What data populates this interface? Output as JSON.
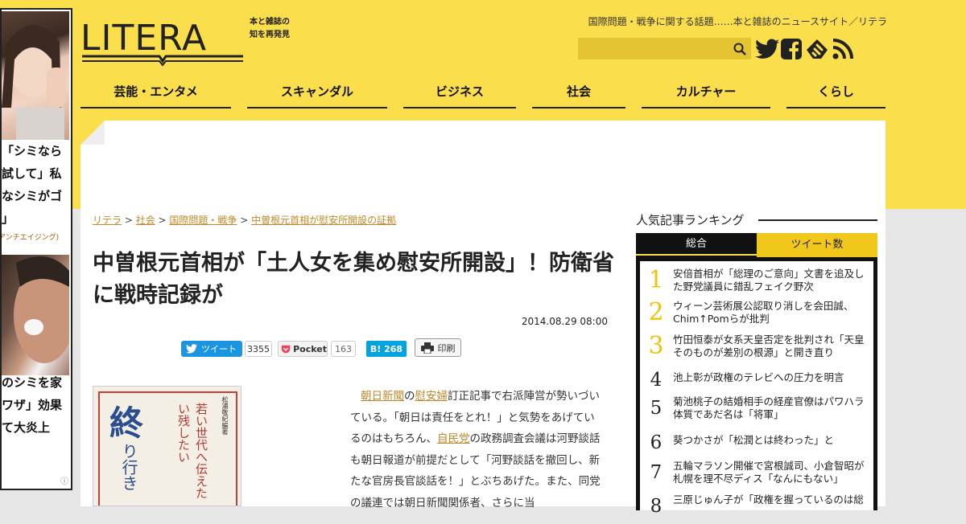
{
  "ad_left": {
    "line1": "「シミなら",
    "line2": "試して」私",
    "line3": "なシミがゴ",
    "line4": "」",
    "small": "アンチエイジング)",
    "line5": "のシミを家",
    "line6": "ワザ」効果",
    "line7": "て大炎上",
    "info_icon": "info-icon"
  },
  "header": {
    "logo_text": "LITERA",
    "logo_sub1": "本と雑誌の",
    "logo_sub2": "知を再発見",
    "tagline": "国際問題・戦争に関する話題……本と雑誌のニュースサイト／リテラ",
    "search_placeholder": ""
  },
  "nav": [
    "芸能・エンタメ",
    "スキャンダル",
    "ビジネス",
    "社会",
    "カルチャー",
    "くらし"
  ],
  "breadcrumb": {
    "home": "リテラ",
    "sep1": " > ",
    "cat1": "社会",
    "sep2": " > ",
    "cat2": "国際問題・戦争",
    "sep3": " > ",
    "current": "中曽根元首相が慰安所開設の証拠"
  },
  "article": {
    "title": "中曽根元首相が「土人女を集め慰安所開設」！防衛省に戦時記録が",
    "date": "2014.08.29 08:00",
    "body_link1": "朝日新聞",
    "body_p1": "の",
    "body_link2": "慰安婦",
    "body_p2": "訂正記事で右派陣営が勢いづいている。「朝日は責任をとれ！」と気勢をあげているのはもちろん、",
    "body_link3": "自民党",
    "body_p3": "の政務調査会議は河野談話も朝日報道が前提だとして「河野談話を撤回し、新たな官房長官談話を！」とぶちあげた。また、同党の議連では朝日新聞関係者、さらに当"
  },
  "share": {
    "tweet_label": "ツイート",
    "tweet_count": "3355",
    "pocket_label": "Pocket",
    "pocket_count": "163",
    "hatena_label": "B! 268",
    "print_label": "印刷"
  },
  "book": {
    "author": "松浦敬紀編著",
    "title_big": "終",
    "title_small": "り行き",
    "subtitle": "若い世代へ伝えたい残したい"
  },
  "ranking": {
    "title": "人気記事ランキング",
    "tab_total": "総合",
    "tab_tweet": "ツイート数",
    "items": [
      {
        "num": "1",
        "text": "安倍首相が「総理のご意向」文書を追及した野党議員に錯乱フェイク野次"
      },
      {
        "num": "2",
        "text": "ウィーン芸術展公認取り消しを会田誠、Chim↑Pomらが批判"
      },
      {
        "num": "3",
        "text": "竹田恒泰が女系天皇否定を批判され「天皇そのものが差別の根源」と開き直り"
      },
      {
        "num": "4",
        "text": "池上彰が政権のテレビへの圧力を明言"
      },
      {
        "num": "5",
        "text": "菊池桃子の結婚相手の経産官僚はパワハラ体質であだ名は「将軍」"
      },
      {
        "num": "6",
        "text": "葵つかさが「松潤とは終わった」と"
      },
      {
        "num": "7",
        "text": "五輪マラソン開催で宮根誠司、小倉智昭が札幌を理不尽ディス「なんにもない」"
      },
      {
        "num": "8",
        "text": "三原じゅん子が「政権を握っているのは総"
      }
    ]
  },
  "colors": {
    "brand_yellow": "#fbde4b",
    "link": "#c0882a",
    "twitter": "#1b95e0",
    "hatena": "#00a4de"
  },
  "icons": [
    "search-icon",
    "twitter-icon",
    "facebook-icon",
    "feedly-icon",
    "rss-icon",
    "print-icon",
    "pocket-icon"
  ]
}
